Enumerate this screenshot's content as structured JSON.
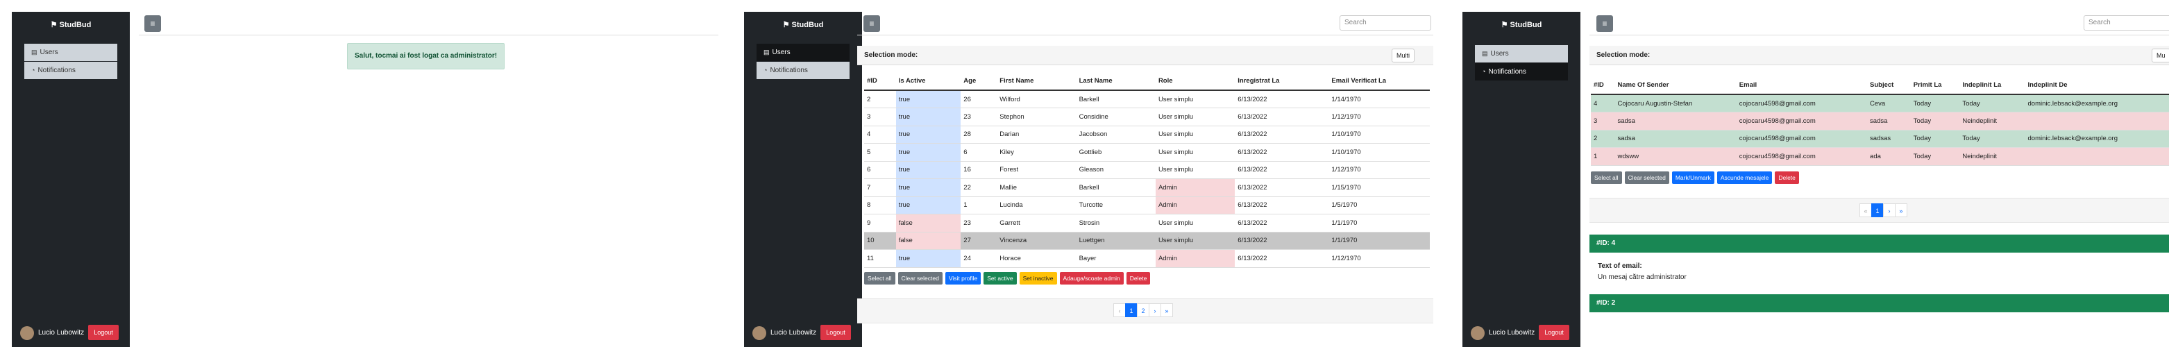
{
  "app": {
    "brand": "StudBud"
  },
  "sidebar": {
    "users": "Users",
    "notifications": "Notifications"
  },
  "user": {
    "name": "Lucio Lubowitz",
    "logout": "Logout"
  },
  "panel1": {
    "alert": "Salut, tocmai ai fost logat ca administrator!"
  },
  "panel2": {
    "search_placeholder": "Search",
    "selection_mode": "Selection mode:",
    "selection_mode_value": "Multi",
    "columns": [
      "#ID",
      "Is Active",
      "Age",
      "First Name",
      "Last Name",
      "Role",
      "Inregistrat La",
      "Email Verificat La"
    ],
    "rows": [
      [
        "2",
        "true",
        "26",
        "Wilford",
        "Barkell",
        "User simplu",
        "6/13/2022",
        "1/14/1970"
      ],
      [
        "3",
        "true",
        "23",
        "Stephon",
        "Considine",
        "User simplu",
        "6/13/2022",
        "1/12/1970"
      ],
      [
        "4",
        "true",
        "28",
        "Darian",
        "Jacobson",
        "User simplu",
        "6/13/2022",
        "1/10/1970"
      ],
      [
        "5",
        "true",
        "6",
        "Kiley",
        "Gottlieb",
        "User simplu",
        "6/13/2022",
        "1/10/1970"
      ],
      [
        "6",
        "true",
        "16",
        "Forest",
        "Gleason",
        "User simplu",
        "6/13/2022",
        "1/12/1970"
      ],
      [
        "7",
        "true",
        "22",
        "Mallie",
        "Barkell",
        "Admin",
        "6/13/2022",
        "1/15/1970"
      ],
      [
        "8",
        "true",
        "1",
        "Lucinda",
        "Turcotte",
        "Admin",
        "6/13/2022",
        "1/5/1970"
      ],
      [
        "9",
        "false",
        "23",
        "Garrett",
        "Strosin",
        "User simplu",
        "6/13/2022",
        "1/1/1970"
      ],
      [
        "10",
        "false",
        "27",
        "Vincenza",
        "Luettgen",
        "User simplu",
        "6/13/2022",
        "1/1/1970"
      ],
      [
        "11",
        "true",
        "24",
        "Horace",
        "Bayer",
        "Admin",
        "6/13/2022",
        "1/12/1970"
      ]
    ],
    "buttons": [
      "Select all",
      "Clear selected",
      "Visit profile",
      "Set active",
      "Set inactive",
      "Adauga/scoate admin",
      "Delete"
    ],
    "pager": [
      "‹",
      "1",
      "2",
      "›",
      "»"
    ]
  },
  "panel3": {
    "search_placeholder": "Search",
    "selection_mode": "Selection mode:",
    "selection_mode_value": "Mu",
    "columns": [
      "#ID",
      "Name Of Sender",
      "Email",
      "Subject",
      "Primit La",
      "Indeplinit La",
      "Indeplinit De"
    ],
    "rows": [
      [
        "4",
        "Cojocaru Augustin-Stefan",
        "cojocaru4598@gmail.com",
        "Ceva",
        "Today",
        "Today",
        "dominic.lebsack@example.org"
      ],
      [
        "3",
        "sadsa",
        "cojocaru4598@gmail.com",
        "sadsa",
        "Today",
        "Neindeplinit",
        ""
      ],
      [
        "2",
        "sadsa",
        "cojocaru4598@gmail.com",
        "sadsas",
        "Today",
        "Today",
        "dominic.lebsack@example.org"
      ],
      [
        "1",
        "wdsww",
        "cojocaru4598@gmail.com",
        "ada",
        "Today",
        "Neindeplinit",
        ""
      ]
    ],
    "buttons": [
      "Select all",
      "Clear selected",
      "Mark/Unmark",
      "Ascunde mesajele",
      "Delete"
    ],
    "pager": [
      "«",
      "1",
      "›",
      "»"
    ],
    "detail1_title": "#ID: 4",
    "detail1_label": "Text of email:",
    "detail1_text": "Un mesaj către administrator",
    "detail2_title": "#ID: 2"
  },
  "colors": {
    "sidebar_bg": "#212529",
    "active_true": "#cfe2ff",
    "active_false": "#f8d7da",
    "selected_row": "#c6c6c6",
    "done_row": "#c3dfd0",
    "pending_row": "#f5d5d8",
    "green": "#198754"
  }
}
